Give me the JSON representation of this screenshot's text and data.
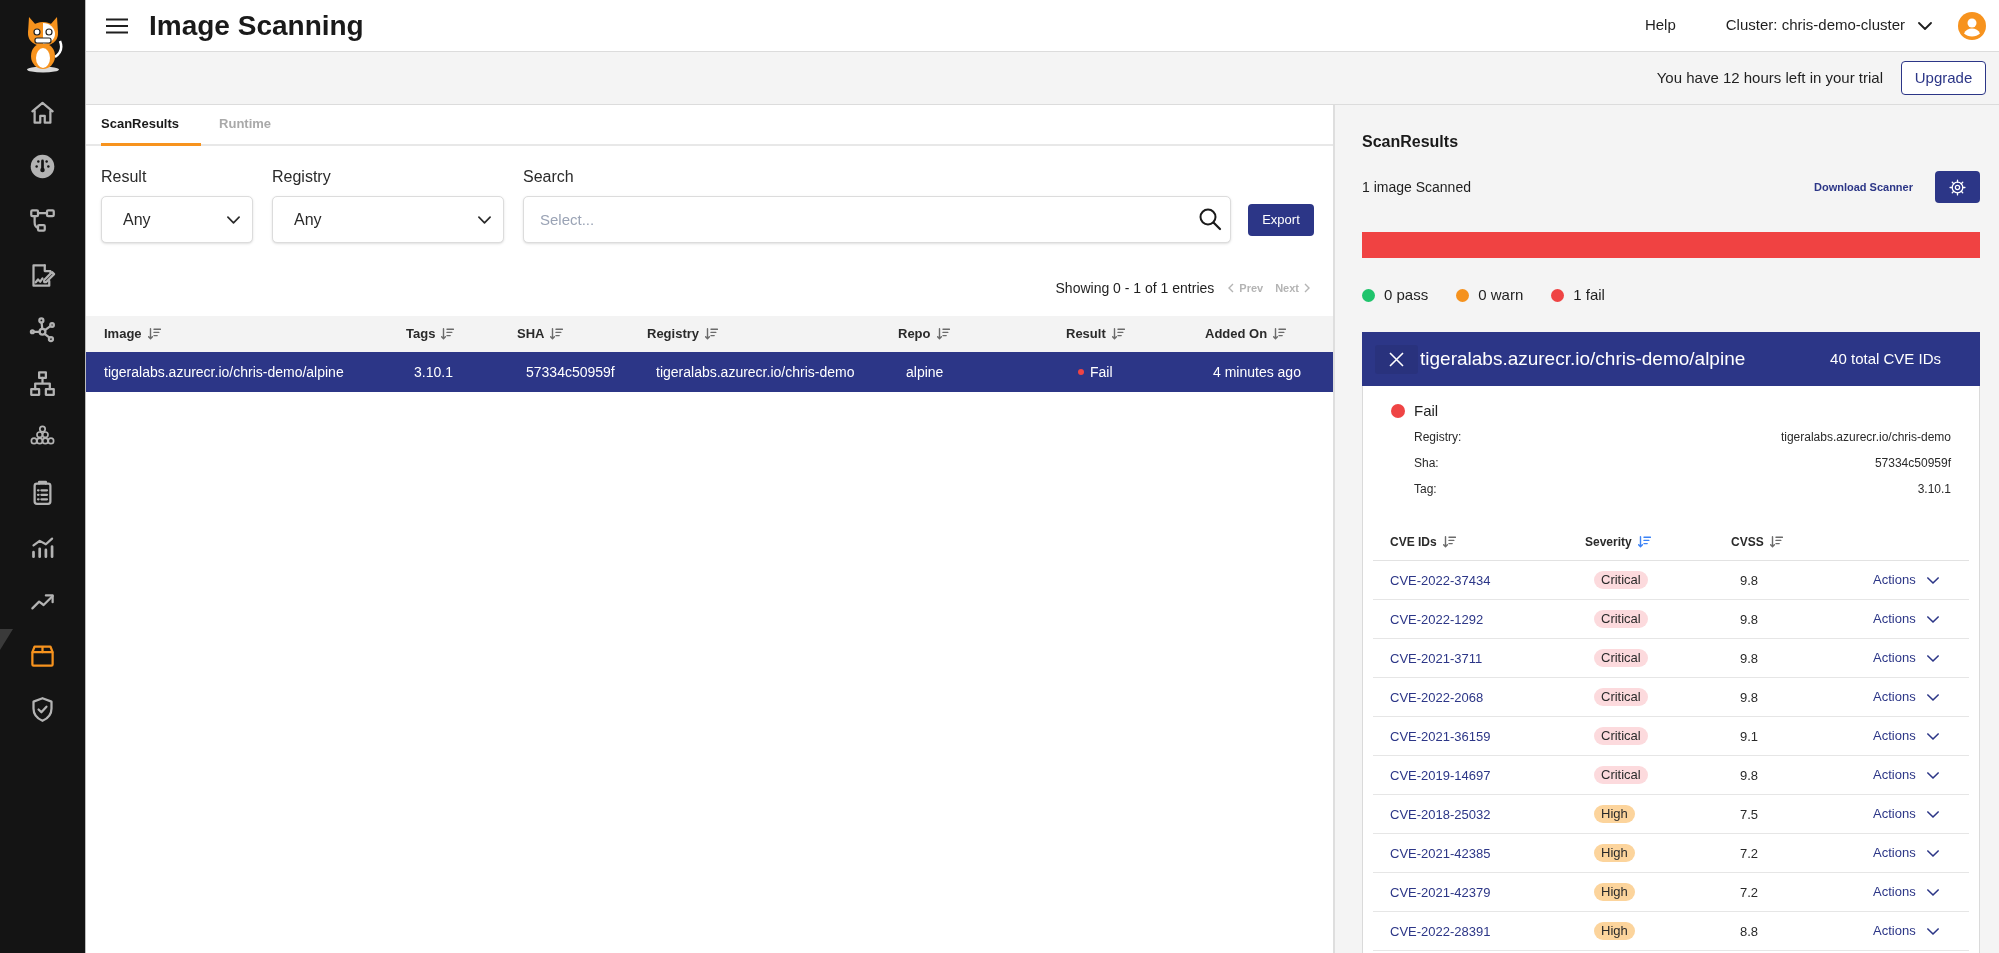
{
  "sidebar": {
    "items": [
      {
        "selected": false
      },
      {
        "selected": false
      },
      {
        "selected": false
      },
      {
        "selected": false
      },
      {
        "selected": false
      },
      {
        "selected": false
      },
      {
        "selected": false
      },
      {
        "selected": false
      },
      {
        "selected": false
      },
      {
        "selected": false
      },
      {
        "selected": true
      },
      {
        "selected": false
      }
    ]
  },
  "header": {
    "title": "Image Scanning",
    "help": "Help",
    "cluster": "Cluster: chris-demo-cluster"
  },
  "trial_bar": {
    "message": "You have 12 hours left in your trial",
    "button": "Upgrade"
  },
  "tabs": [
    {
      "label": "ScanResults",
      "selected": true
    },
    {
      "label": "Runtime",
      "selected": false
    }
  ],
  "filters": [
    {
      "kind": "select",
      "label": "Result",
      "value": "Any"
    },
    {
      "kind": "select",
      "label": "Registry",
      "value": "Any"
    },
    {
      "kind": "search",
      "label": "Search",
      "placeholder": "Select..."
    }
  ],
  "export_button": "Export",
  "pagination": {
    "summary": "Showing 0 - 1 of 1 entries",
    "prev": {
      "label": "Prev",
      "disabled": true
    },
    "next": {
      "label": "Next",
      "disabled": true
    }
  },
  "table": {
    "columns": [
      {
        "label": "Image",
        "sorted": false
      },
      {
        "label": "Tags",
        "sorted": false
      },
      {
        "label": "SHA",
        "sorted": false
      },
      {
        "label": "Registry",
        "sorted": false
      },
      {
        "label": "Repo",
        "sorted": false
      },
      {
        "label": "Result",
        "sorted": false
      },
      {
        "label": "Added On",
        "sorted": false
      }
    ],
    "rows": [
      {
        "selected": true,
        "image": "tigeralabs.azurecr.io/chris-demo/alpine",
        "tags": "3.10.1",
        "sha": "57334c50959f",
        "registry": "tigeralabs.azurecr.io/chris-demo",
        "repo": "alpine",
        "result": {
          "label": "Fail",
          "color": "#ef4444"
        },
        "added_on": "4 minutes ago"
      }
    ]
  },
  "scan_summary": {
    "title": "ScanResults",
    "count": "1 image Scanned",
    "download": "Download Scanner",
    "result_bar": {
      "level": 1
    },
    "legend": [
      {
        "label": "0 pass",
        "color": "#1fc46c"
      },
      {
        "label": "0 warn",
        "color": "#f5921e"
      },
      {
        "label": "1 fail",
        "color": "#ef4444"
      }
    ]
  },
  "image_card": {
    "title": "tigeralabs.azurecr.io/chris-demo/alpine",
    "total": "40 total CVE IDs",
    "status": {
      "label": "Fail",
      "color": "#ef4444"
    },
    "fields": [
      {
        "label": "Registry:",
        "value": "tigeralabs.azurecr.io/chris-demo"
      },
      {
        "label": "Sha:",
        "value": "57334c50959f"
      },
      {
        "label": "Tag:",
        "value": "3.10.1"
      }
    ],
    "cve_table": {
      "columns": [
        {
          "label": "CVE IDs",
          "sorted": false
        },
        {
          "label": "Severity",
          "sorted": true
        },
        {
          "label": "CVSS",
          "sorted": false
        }
      ],
      "rows": [
        {
          "id": "CVE-2022-37434",
          "severity": {
            "label": "Critical",
            "kind": "critical"
          },
          "cvss": "9.8",
          "action": "Actions"
        },
        {
          "id": "CVE-2022-1292",
          "severity": {
            "label": "Critical",
            "kind": "critical"
          },
          "cvss": "9.8",
          "action": "Actions"
        },
        {
          "id": "CVE-2021-3711",
          "severity": {
            "label": "Critical",
            "kind": "critical"
          },
          "cvss": "9.8",
          "action": "Actions"
        },
        {
          "id": "CVE-2022-2068",
          "severity": {
            "label": "Critical",
            "kind": "critical"
          },
          "cvss": "9.8",
          "action": "Actions"
        },
        {
          "id": "CVE-2021-36159",
          "severity": {
            "label": "Critical",
            "kind": "critical"
          },
          "cvss": "9.1",
          "action": "Actions"
        },
        {
          "id": "CVE-2019-14697",
          "severity": {
            "label": "Critical",
            "kind": "critical"
          },
          "cvss": "9.8",
          "action": "Actions"
        },
        {
          "id": "CVE-2018-25032",
          "severity": {
            "label": "High",
            "kind": "high"
          },
          "cvss": "7.5",
          "action": "Actions"
        },
        {
          "id": "CVE-2021-42385",
          "severity": {
            "label": "High",
            "kind": "high"
          },
          "cvss": "7.2",
          "action": "Actions"
        },
        {
          "id": "CVE-2021-42379",
          "severity": {
            "label": "High",
            "kind": "high"
          },
          "cvss": "7.2",
          "action": "Actions"
        },
        {
          "id": "CVE-2022-28391",
          "severity": {
            "label": "High",
            "kind": "high"
          },
          "cvss": "8.8",
          "action": "Actions"
        }
      ]
    }
  }
}
